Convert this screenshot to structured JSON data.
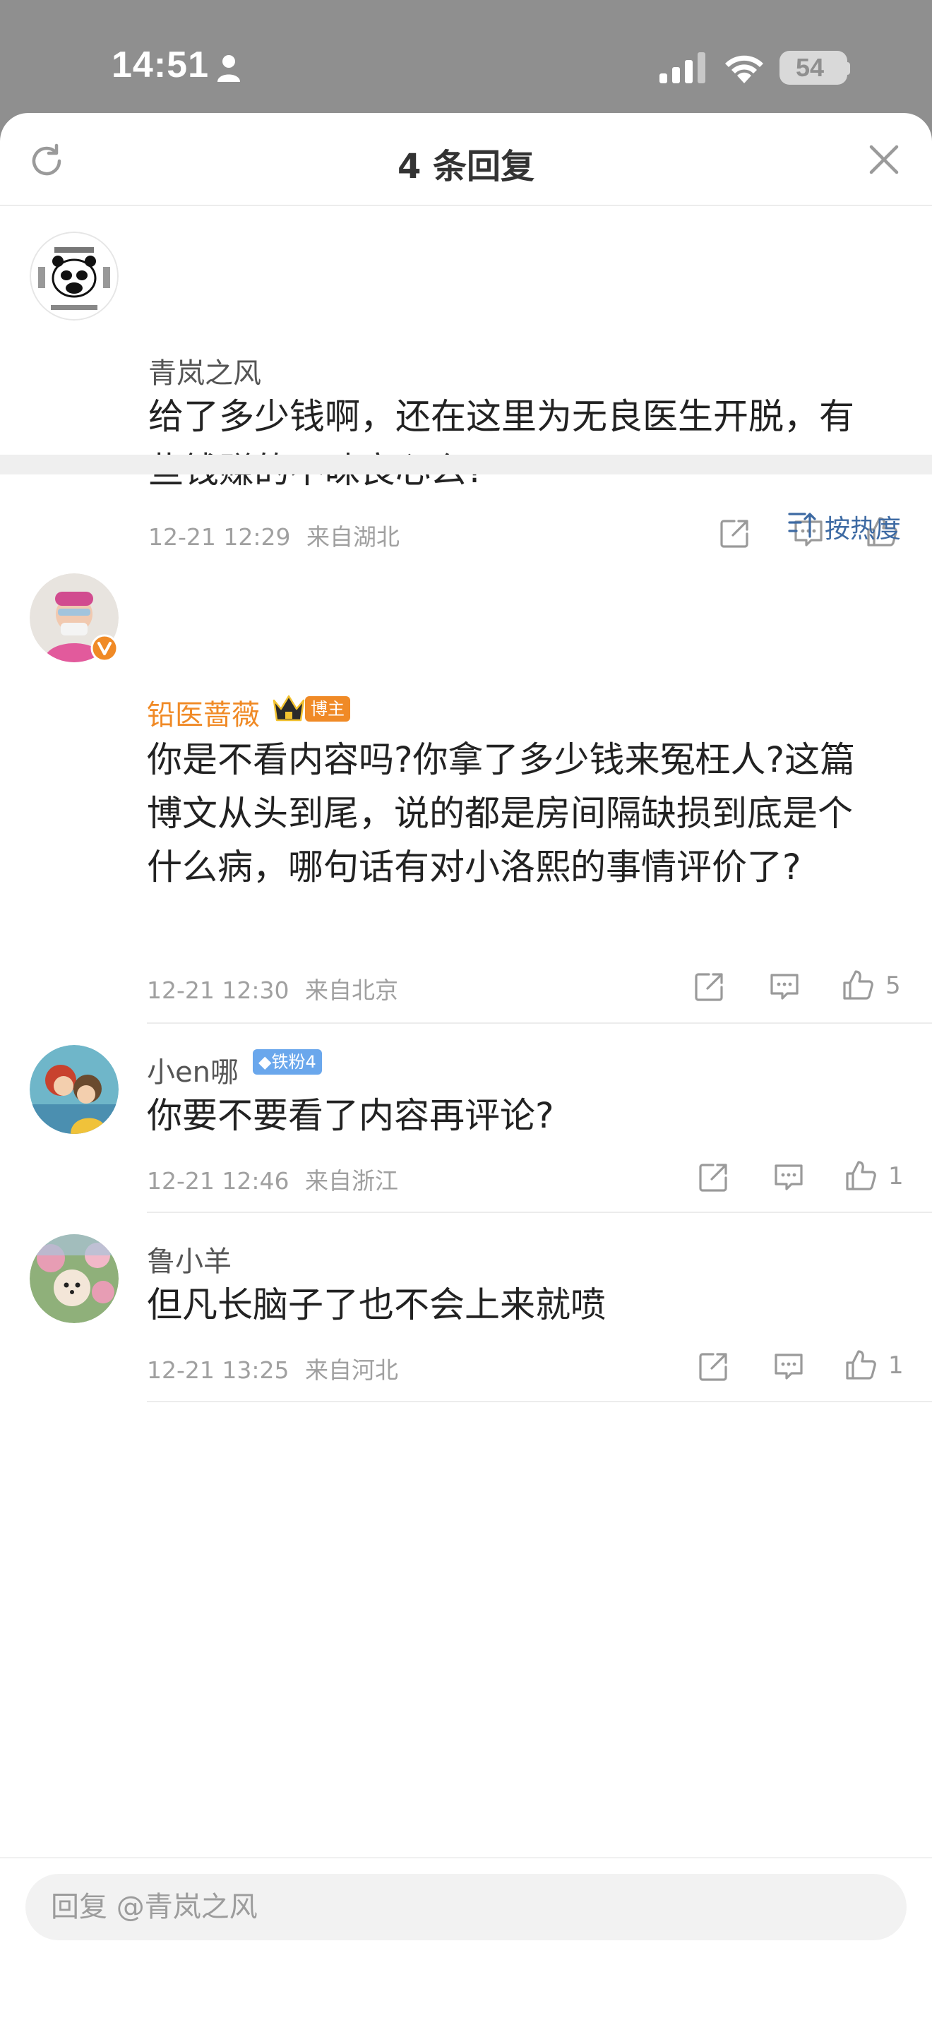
{
  "status_bar": {
    "time": "14:51",
    "battery": "54"
  },
  "header": {
    "title": "4 条回复"
  },
  "original_comment": {
    "user": "青岚之风",
    "text": "给了多少钱啊，还在这里为无良医生开脱，有些钱赚的不昧良心么?",
    "time": "12-21 12:29",
    "location": "来自湖北"
  },
  "sort": {
    "label": "按热度"
  },
  "replies": [
    {
      "user": "铅医蔷薇",
      "badge": "博主",
      "text": "你是不看内容吗?你拿了多少钱来冤枉人?这篇博文从头到尾，说的都是房间隔缺损到底是个什么病，哪句话有对小洛熙的事情评价了?",
      "time": "12-21 12:30",
      "location": "来自北京",
      "likes": "5"
    },
    {
      "user": "小en哪",
      "badge": "铁粉4",
      "text": "你要不要看了内容再评论?",
      "time": "12-21 12:46",
      "location": "来自浙江",
      "likes": "1"
    },
    {
      "user": "鲁小羊",
      "text": "但凡长脑子了也不会上来就喷",
      "time": "12-21 13:25",
      "location": "来自河北",
      "likes": "1"
    }
  ],
  "reply_input": {
    "placeholder": "回复 @青岚之风"
  },
  "colors": {
    "accent_orange": "#f08a26",
    "link_blue": "#3d6aa3",
    "fan_badge": "#6aa7ec"
  }
}
